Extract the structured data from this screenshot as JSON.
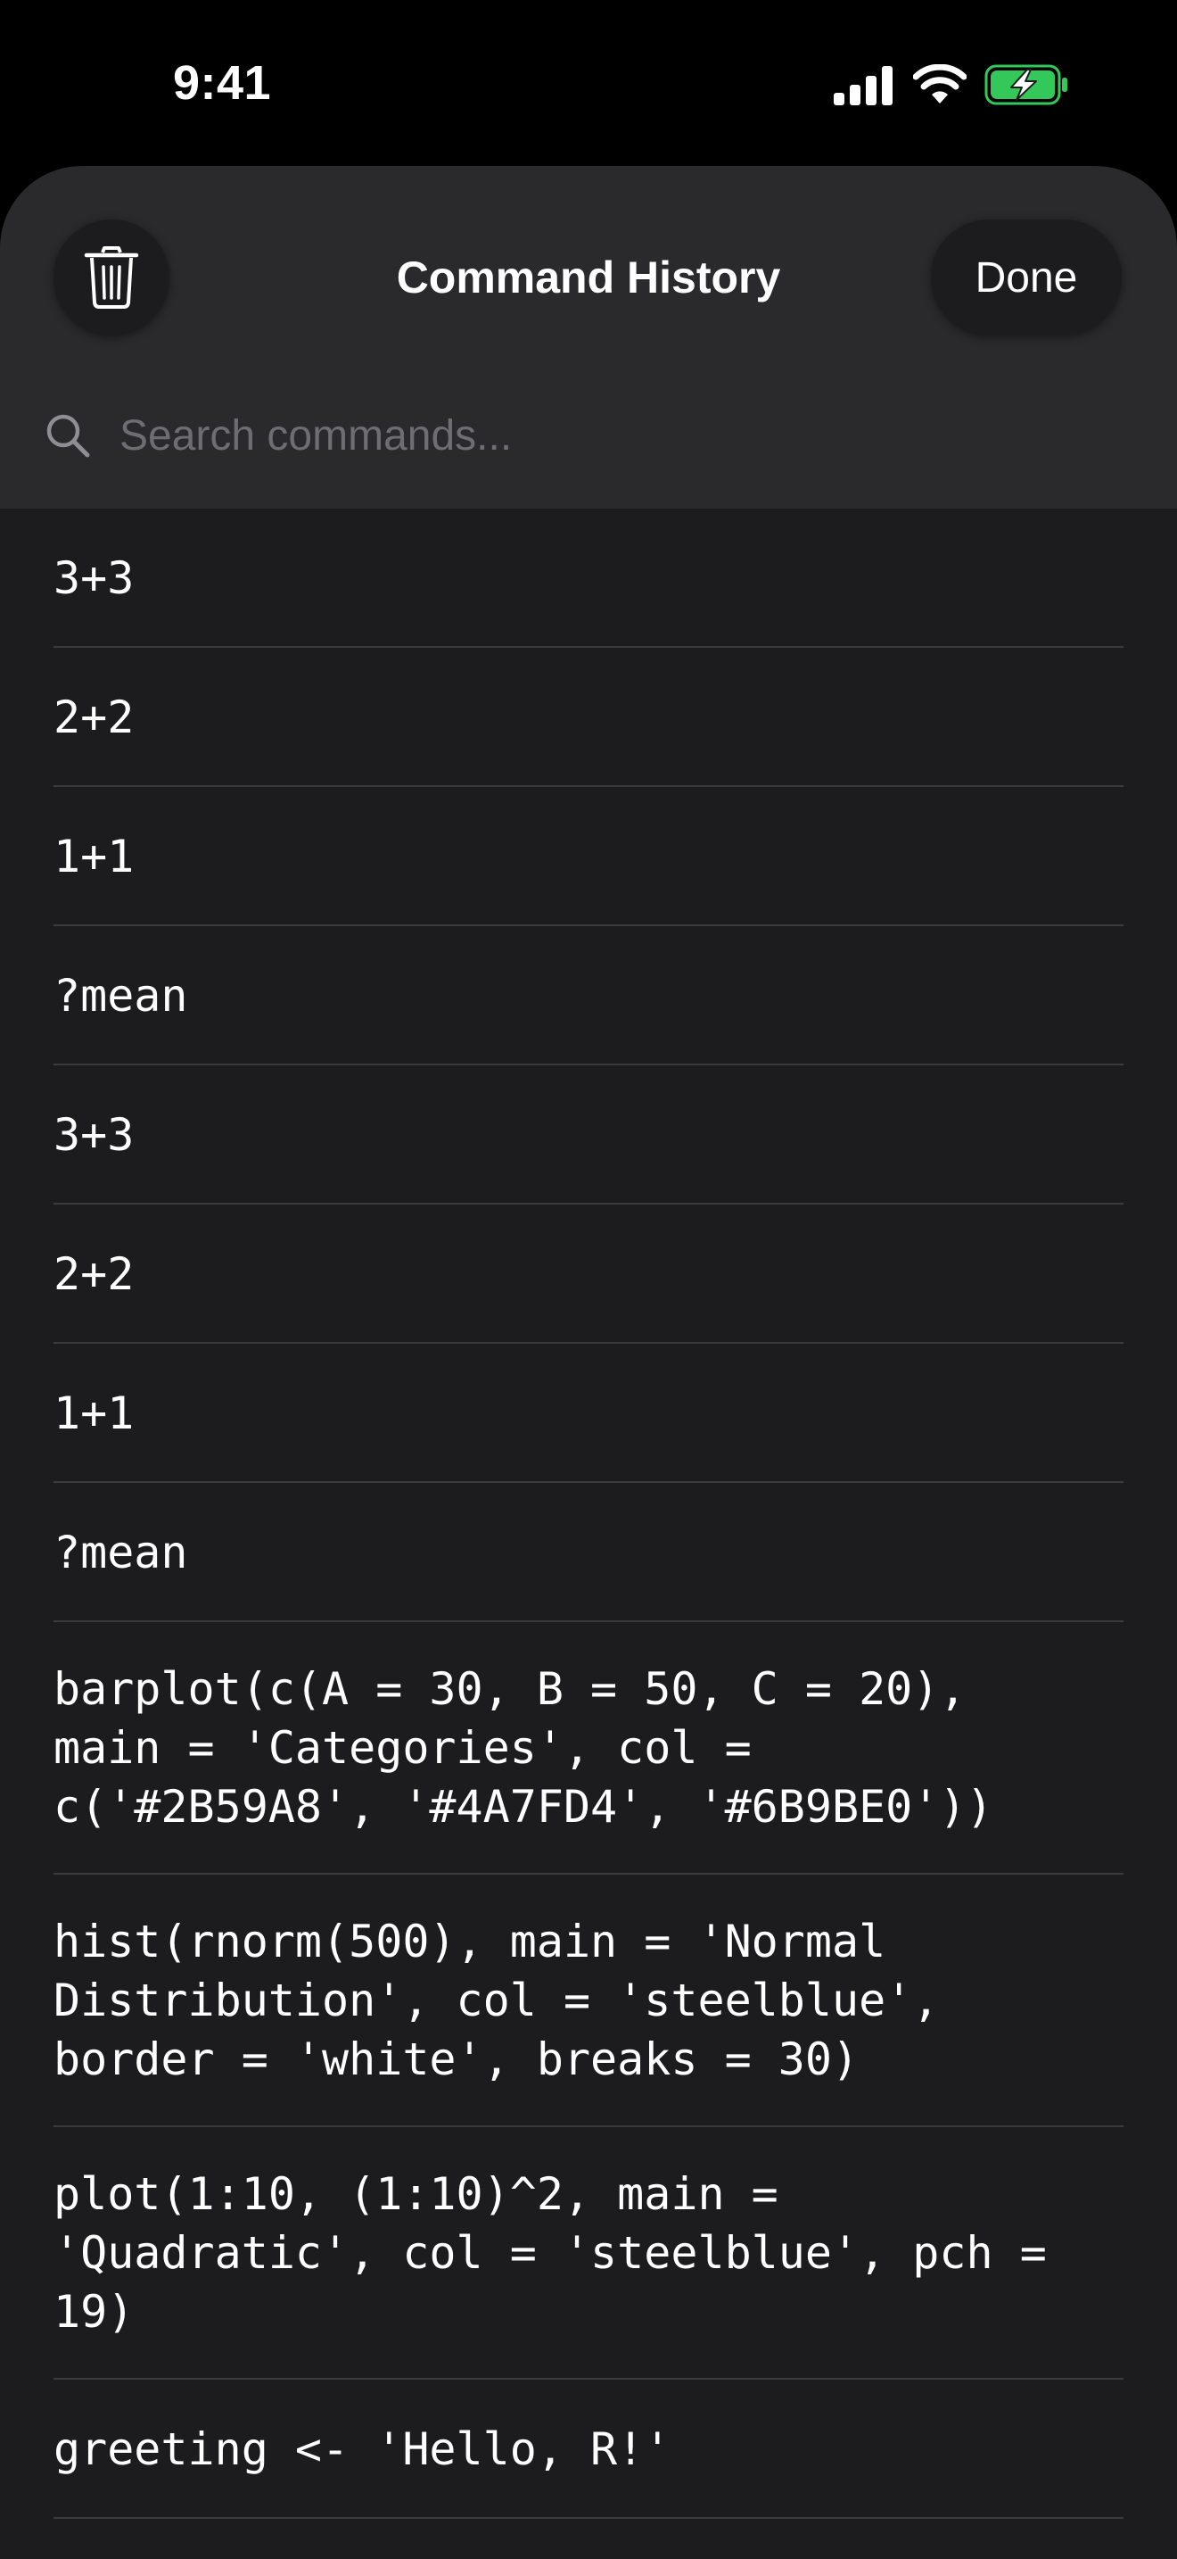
{
  "status_bar": {
    "time": "9:41",
    "icons": [
      "cellular-signal-icon",
      "wifi-icon",
      "battery-charging-icon"
    ],
    "battery_color": "#34c759"
  },
  "sheet": {
    "title": "Command History",
    "trash_icon": "trash-icon",
    "done_label": "Done",
    "search": {
      "icon": "search-icon",
      "placeholder": "Search commands...",
      "value": ""
    }
  },
  "history": {
    "items": [
      {
        "command": "3+3"
      },
      {
        "command": "2+2"
      },
      {
        "command": "1+1"
      },
      {
        "command": "?mean"
      },
      {
        "command": "3+3"
      },
      {
        "command": "2+2"
      },
      {
        "command": "1+1"
      },
      {
        "command": "?mean"
      },
      {
        "command": "barplot(c(A = 30, B = 50, C = 20),\nmain = 'Categories', col =\nc('#2B59A8', '#4A7FD4', '#6B9BE0'))"
      },
      {
        "command": "hist(rnorm(500), main = 'Normal\nDistribution', col = 'steelblue',\nborder = 'white', breaks = 30)"
      },
      {
        "command": "plot(1:10, (1:10)^2, main =\n'Quadratic', col = 'steelblue', pch =\n19)"
      },
      {
        "command": "greeting <- 'Hello, R!'"
      }
    ]
  }
}
